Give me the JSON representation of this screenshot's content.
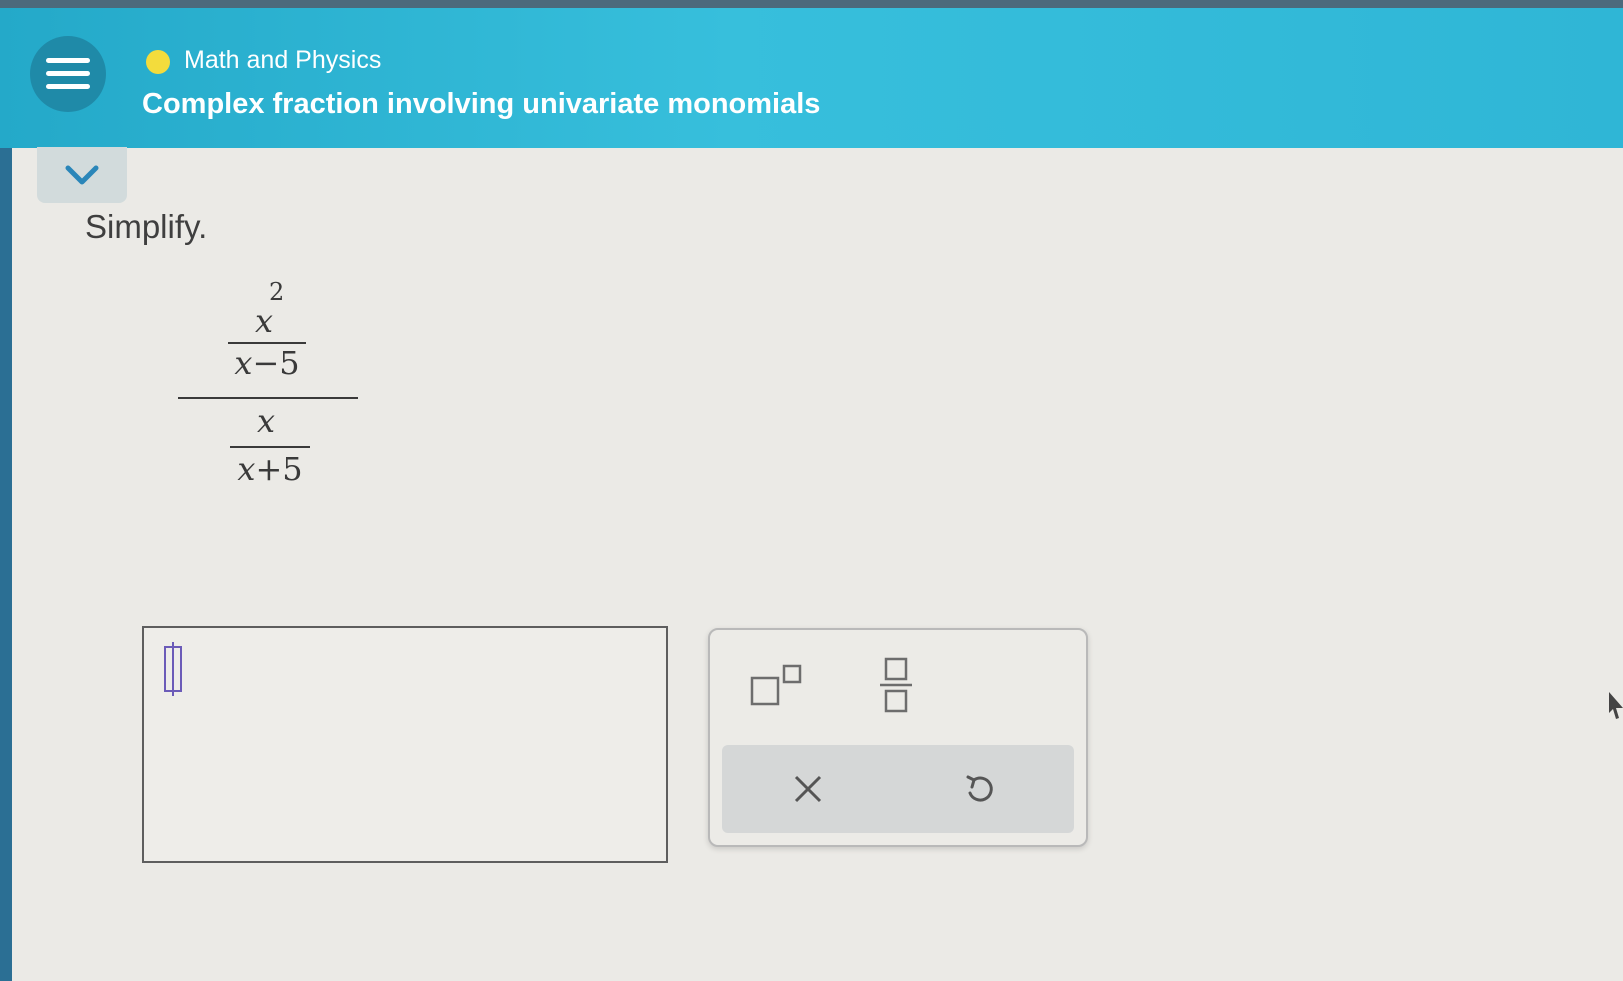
{
  "header": {
    "topic": "Math and Physics",
    "title": "Complex fraction involving univariate monomials"
  },
  "problem": {
    "instruction": "Simplify.",
    "expression": {
      "outer_numerator": {
        "numerator": "x",
        "numerator_exponent": "2",
        "denominator_var": "x",
        "denominator_op": "−",
        "denominator_const": "5"
      },
      "outer_denominator": {
        "numerator": "x",
        "denominator_var": "x",
        "denominator_op": "+",
        "denominator_const": "5"
      }
    }
  },
  "answer": {
    "value": ""
  },
  "toolbox": {
    "icons": [
      "superscript-icon",
      "fraction-icon",
      "clear-icon",
      "undo-icon"
    ]
  },
  "colors": {
    "header": "#2fb6d6",
    "menu_button": "#1f8aa8",
    "topic_dot": "#f3dc3c",
    "cursor": "#6b5bb8"
  }
}
